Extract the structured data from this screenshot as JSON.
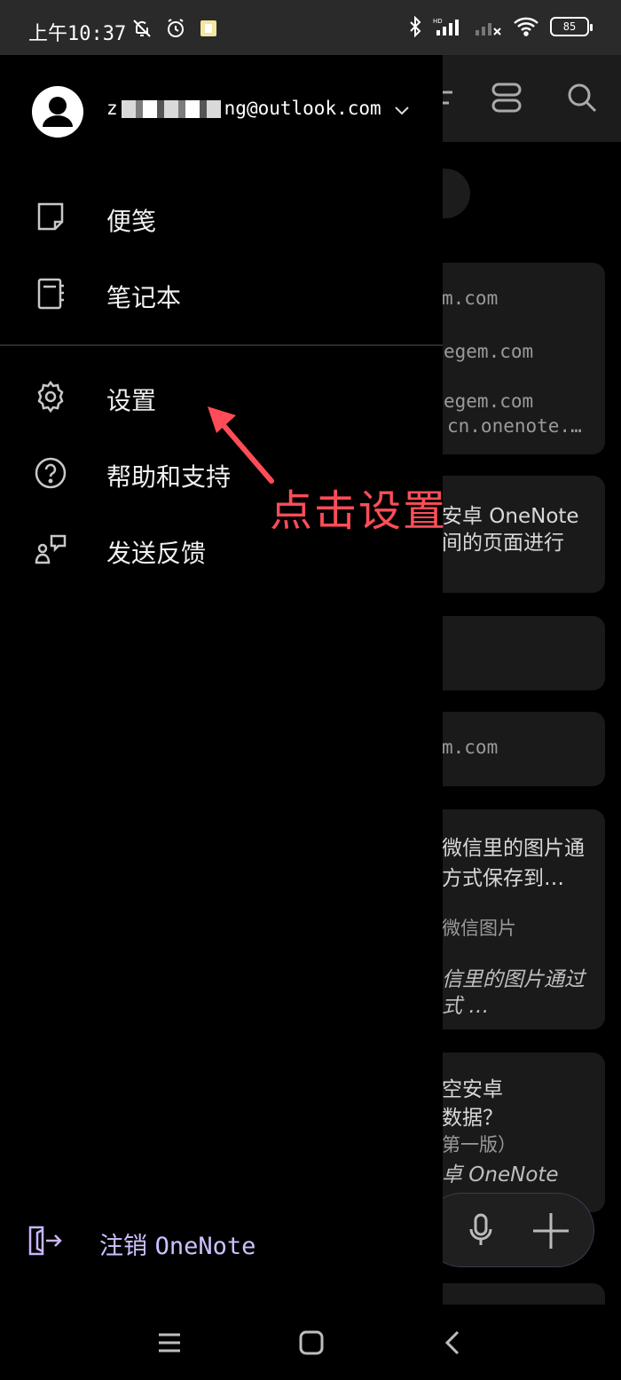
{
  "status_bar": {
    "time": "上午10:37",
    "battery": "85",
    "icons_left": [
      "bell-off-icon",
      "alarm-icon",
      "notification-app-icon"
    ],
    "icons_right": [
      "bluetooth-icon",
      "signal-hd-icon",
      "signal-no-service-icon",
      "wifi-icon",
      "battery-icon"
    ]
  },
  "drawer": {
    "account": {
      "email_prefix": "z",
      "email_suffix": "ng@outlook.com"
    },
    "items": [
      {
        "label": "便笺",
        "icon": "sticky-note-icon"
      },
      {
        "label": "笔记本",
        "icon": "notebook-icon"
      },
      {
        "label": "设置",
        "icon": "gear-icon"
      },
      {
        "label": "帮助和支持",
        "icon": "help-icon"
      },
      {
        "label": "发送反馈",
        "icon": "feedback-icon"
      }
    ],
    "sign_out": {
      "label": "注销",
      "app": "OneNote",
      "icon": "sign-out-icon"
    }
  },
  "annotation": {
    "text": "点击设置",
    "color": "#ff4d57"
  },
  "background_app": {
    "cards": [
      {
        "lines": [
          "m.com",
          "egem.com",
          "egem.com",
          "cn.onenote.…"
        ]
      },
      {
        "lines": [
          "安卓 OneNote",
          "间的页面进行"
        ]
      },
      {
        "lines": []
      },
      {
        "lines": [
          "m.com"
        ]
      },
      {
        "lines": [
          "微信里的图片通",
          "方式保存到…",
          "微信图片",
          "信里的图片通过",
          "式 …"
        ]
      },
      {
        "lines": [
          "空安卓",
          "数据？",
          "第一版）",
          "卓 OneNote"
        ]
      }
    ]
  },
  "colors": {
    "accent": "#c8b6ff",
    "annotation": "#ff4d57"
  }
}
